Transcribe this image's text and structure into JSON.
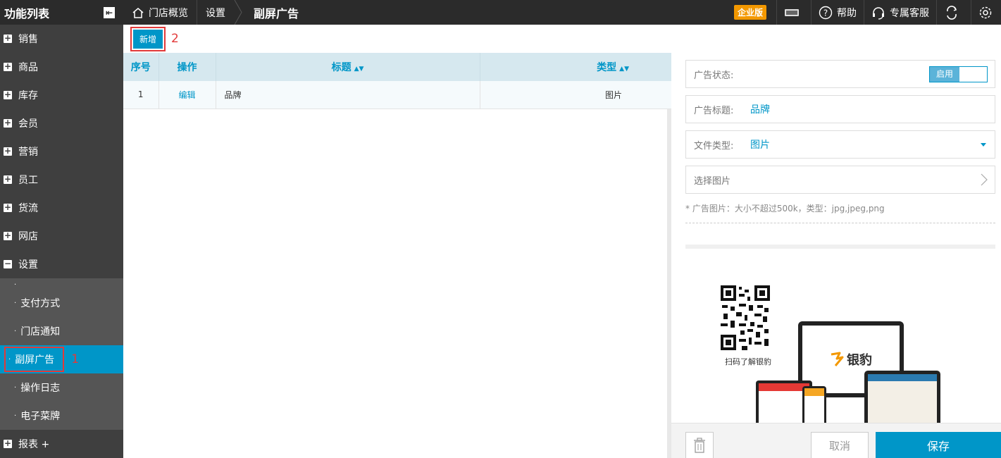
{
  "sidebar": {
    "title": "功能列表",
    "menu": [
      {
        "label": "销售"
      },
      {
        "label": "商品"
      },
      {
        "label": "库存"
      },
      {
        "label": "会员"
      },
      {
        "label": "营销"
      },
      {
        "label": "员工"
      },
      {
        "label": "货流"
      },
      {
        "label": "网店"
      }
    ],
    "settings_label": "设置",
    "settings_sub": [
      {
        "label": "支付方式"
      },
      {
        "label": "门店通知"
      },
      {
        "label": "副屏广告"
      },
      {
        "label": "操作日志"
      },
      {
        "label": "电子菜牌"
      }
    ],
    "reports_label": "报表 +",
    "marker_1": "1"
  },
  "topbar": {
    "home": "门店概览",
    "settings": "设置",
    "current": "副屏广告",
    "edition_badge": "企业版",
    "help": "帮助",
    "support": "专属客服"
  },
  "toolbar": {
    "add_label": "新增",
    "marker_2": "2"
  },
  "table": {
    "headers": {
      "index": "序号",
      "action": "操作",
      "title": "标题",
      "type": "类型"
    },
    "rows": [
      {
        "index": "1",
        "action": "编辑",
        "title": "品牌",
        "type": "图片"
      }
    ]
  },
  "panel": {
    "status_label": "广告状态:",
    "status_value": "启用",
    "title_label": "广告标题:",
    "title_value": "品牌",
    "filetype_label": "文件类型:",
    "filetype_value": "图片",
    "choose_image": "选择图片",
    "hint": "* 广告图片：大小不超过500k，类型：jpg,jpeg,png",
    "preview": {
      "qr_caption": "扫码了解银豹",
      "logo_text": "银豹"
    },
    "cancel_label": "取消",
    "save_label": "保存"
  },
  "colors": {
    "accent": "#0096c8",
    "sidebar_bg": "#3f3f3f",
    "topbar_bg": "#2b2b2b",
    "badge": "#f39800",
    "highlight_red": "#e23a3a"
  }
}
